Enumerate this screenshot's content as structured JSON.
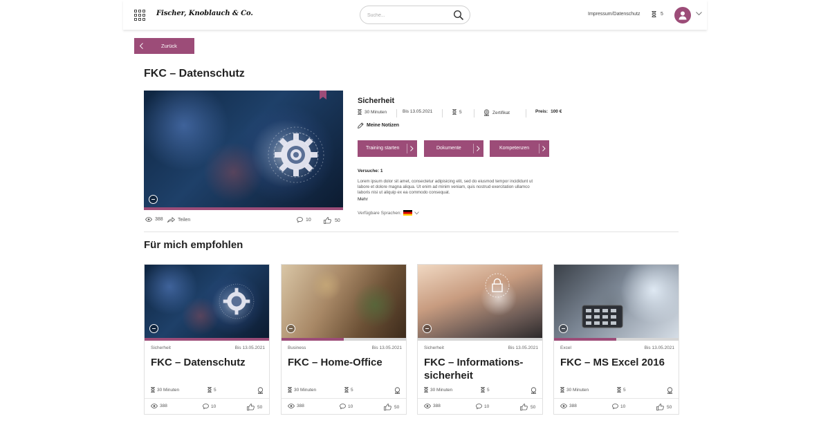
{
  "header": {
    "brand": "Fischer, Knoblauch & Co.",
    "search_placeholder": "Suche...",
    "impressum": "Impressum/Datenschutz",
    "hourglass_count": "5"
  },
  "back_label": "Zurück",
  "page_title": "FKC – Datenschutz",
  "hero": {
    "views": "388",
    "share": "Teilen",
    "comments": "10",
    "likes": "50",
    "progress": 1.0
  },
  "detail": {
    "category": "Sicherheit",
    "duration": "30 Minuten",
    "until": "Bis 13.05.2021",
    "hourglass": "5",
    "certificate": "Zertifikat",
    "price_label": "Preis:",
    "price": "100 €",
    "notes": "Meine Notizen",
    "buttons": [
      "Training starten",
      "Dokumente",
      "Kompetenzen"
    ],
    "attempts": "Versuche: 1",
    "description": "Lorem ipsum dolor sit amet, consectetur adipisicing elit, sed do eiusmod tempor incididunt ut labore et dolore magna aliqua. Ut enim ad minim veniam, quis nostrud exercitation ullamco laboris nisi ut aliquip ex ea commodo consequat.",
    "more": "Mehr",
    "languages_label": "Verfügbare Sprachen:"
  },
  "section_title": "Für mich empfohlen",
  "cards": [
    {
      "category": "Sicherheit",
      "date": "Bis 13.05.2021",
      "title": "FKC – Datenschutz",
      "duration": "30 Minuten",
      "hourglass": "5",
      "views": "388",
      "comments": "10",
      "likes": "50",
      "progress": 1.0
    },
    {
      "category": "Business",
      "date": "Bis 13.05.2021",
      "title": "FKC – Home-Office",
      "duration": "30 Minuten",
      "hourglass": "5",
      "views": "388",
      "comments": "10",
      "likes": "50",
      "progress": 0.5
    },
    {
      "category": "Sicherheit",
      "date": "Bis 13.05.2021",
      "title": "FKC – Informations-sicherheit",
      "duration": "30 Minuten",
      "hourglass": "5",
      "views": "388",
      "comments": "10",
      "likes": "50",
      "progress": 0.0
    },
    {
      "category": "Excel",
      "date": "Bis 13.05.2021",
      "title": "FKC – MS Excel 2016",
      "duration": "30 Minuten",
      "hourglass": "5",
      "views": "388",
      "comments": "10",
      "likes": "50",
      "progress": 0.5
    }
  ],
  "colors": {
    "accent": "#9c4c78",
    "track": "#d6d6d6"
  }
}
